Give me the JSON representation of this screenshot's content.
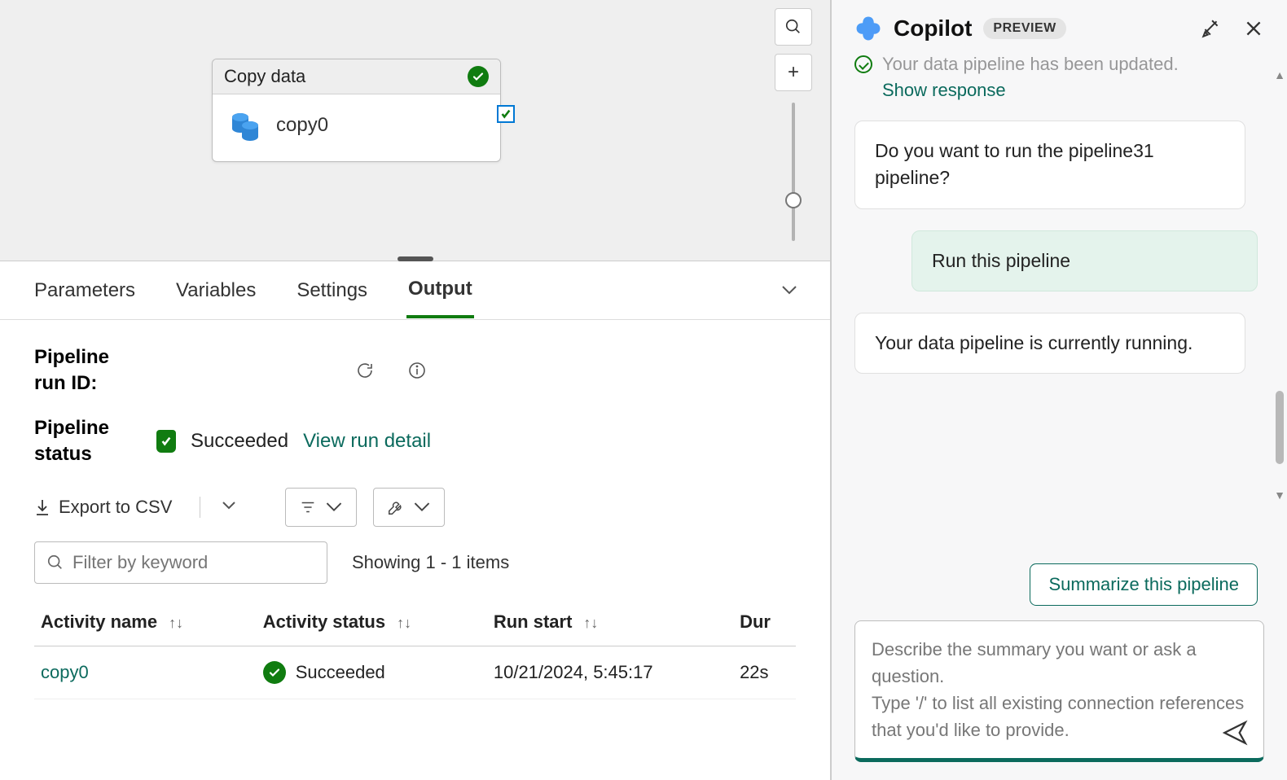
{
  "canvas": {
    "node_title": "Copy data",
    "node_name": "copy0"
  },
  "tabs": {
    "parameters": "Parameters",
    "variables": "Variables",
    "settings": "Settings",
    "output": "Output"
  },
  "output": {
    "run_id_label": "Pipeline\nrun ID:",
    "status_label": "Pipeline\nstatus",
    "status_value": "Succeeded",
    "view_detail": "View run detail",
    "export_csv": "Export to CSV",
    "filter_placeholder": "Filter by keyword",
    "showing": "Showing 1 - 1 items",
    "columns": {
      "activity_name": "Activity name",
      "activity_status": "Activity status",
      "run_start": "Run start",
      "duration": "Dur"
    },
    "rows": [
      {
        "name": "copy0",
        "status": "Succeeded",
        "start": "10/21/2024, 5:45:17",
        "duration": "22s"
      }
    ]
  },
  "copilot": {
    "title": "Copilot",
    "badge": "PREVIEW",
    "partial_msg": "Your data pipeline has been updated.",
    "show_response": "Show response",
    "msg1": "Do you want to run the pipeline31 pipeline?",
    "user_msg": "Run this pipeline",
    "msg2": "Your data pipeline is currently running.",
    "suggestion": "Summarize this pipeline",
    "placeholder": "Describe the summary you want or ask a question.\nType '/' to list all existing connection references that you'd like to provide."
  }
}
